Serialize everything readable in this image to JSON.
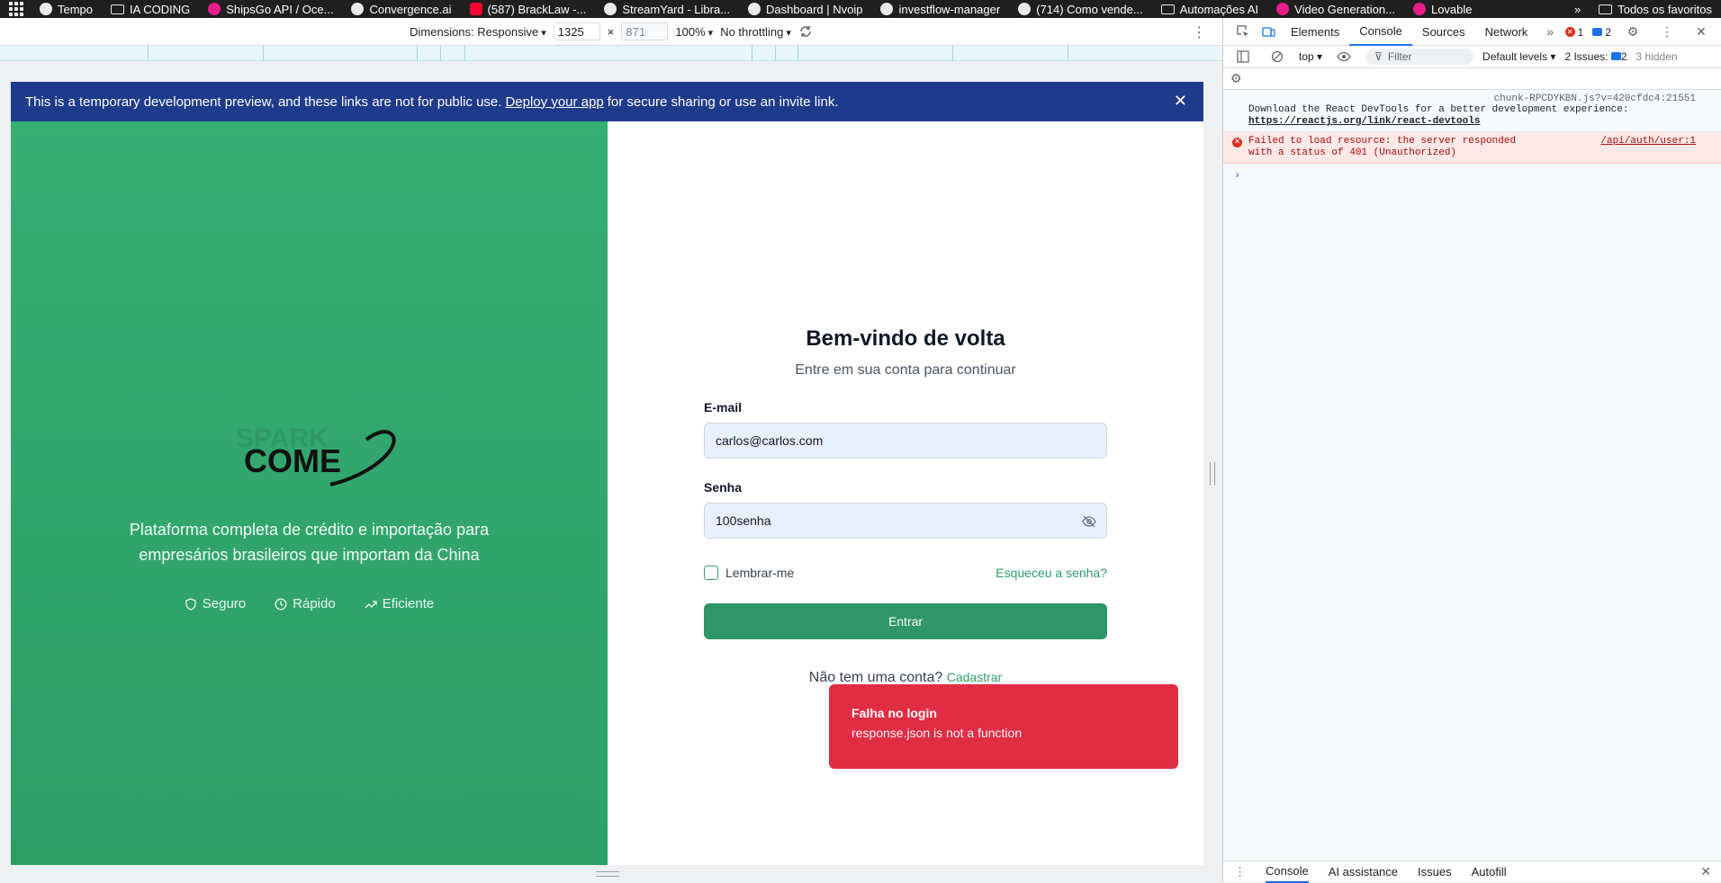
{
  "bookmarks": {
    "items": [
      {
        "label": "Tempo"
      },
      {
        "label": "IA CODING",
        "folder": true
      },
      {
        "label": "ShipsGo API / Oce..."
      },
      {
        "label": "Convergence.ai"
      },
      {
        "label": "(587) BrackLaw -..."
      },
      {
        "label": "StreamYard - Libra..."
      },
      {
        "label": "Dashboard | Nvoip"
      },
      {
        "label": "investflow-manager"
      },
      {
        "label": "(714) Como vende..."
      },
      {
        "label": "Automações AI",
        "folder": true
      },
      {
        "label": "Video Generation..."
      },
      {
        "label": "Lovable"
      }
    ],
    "more": "»",
    "all_bookmarks": "Todos os favoritos"
  },
  "devbar": {
    "dimensions": "Dimensions: Responsive",
    "width": "1325",
    "times": "×",
    "height": "871",
    "zoom": "100%",
    "throttling": "No throttling",
    "kebab": "⋮"
  },
  "banner": {
    "text_before": "This is a temporary development preview, and these links are not for public use.",
    "link": "Deploy your app",
    "text_after": "for secure sharing or use an invite link.",
    "close": "✕"
  },
  "left_panel": {
    "logo_faded": "SPARK",
    "logo": "COME",
    "tagline": "Plataforma completa de crédito e importação para empresários brasileiros que importam da China",
    "features": [
      {
        "icon": "shield-icon",
        "label": "Seguro"
      },
      {
        "icon": "clock-icon",
        "label": "Rápido"
      },
      {
        "icon": "trending-up-icon",
        "label": "Eficiente"
      }
    ]
  },
  "login": {
    "title": "Bem-vindo de volta",
    "subtitle": "Entre em sua conta para continuar",
    "email_label": "E-mail",
    "email_value": "carlos@carlos.com",
    "password_label": "Senha",
    "password_value": "100senha",
    "remember": "Lembrar-me",
    "forgot": "Esqueceu a senha?",
    "submit": "Entrar",
    "no_account": "Não tem uma conta?",
    "signup": "Cadastrar"
  },
  "toast": {
    "title": "Falha no login",
    "message": "response.json is not a function"
  },
  "devtools": {
    "tabs": [
      "Elements",
      "Console",
      "Sources",
      "Network"
    ],
    "active_tab": "Console",
    "more": "»",
    "error_count": "1",
    "issue_count": "2",
    "context": "top",
    "filter_placeholder": "Filter",
    "levels": "Default levels",
    "issues_label": "2 Issues:",
    "issues_count": "2",
    "hidden": "3 hidden",
    "messages": [
      {
        "type": "info",
        "source": "chunk-RPCDYKBN.js?v=420cfdc4:21551",
        "text": "Download the React DevTools for a better development experience:",
        "link": "https://reactjs.org/link/react-devtools"
      },
      {
        "type": "error",
        "source": "/api/auth/user:1",
        "text": "Failed to load resource: the server responded with a status of 401 (Unauthorized)"
      }
    ],
    "prompt": "›",
    "drawer_tabs": [
      "Console",
      "AI assistance",
      "Issues",
      "Autofill"
    ],
    "drawer_close": "✕"
  },
  "colors": {
    "brand_green": "#2e9e67",
    "banner_blue": "#1e3a8a",
    "toast_red": "#e02d44"
  }
}
